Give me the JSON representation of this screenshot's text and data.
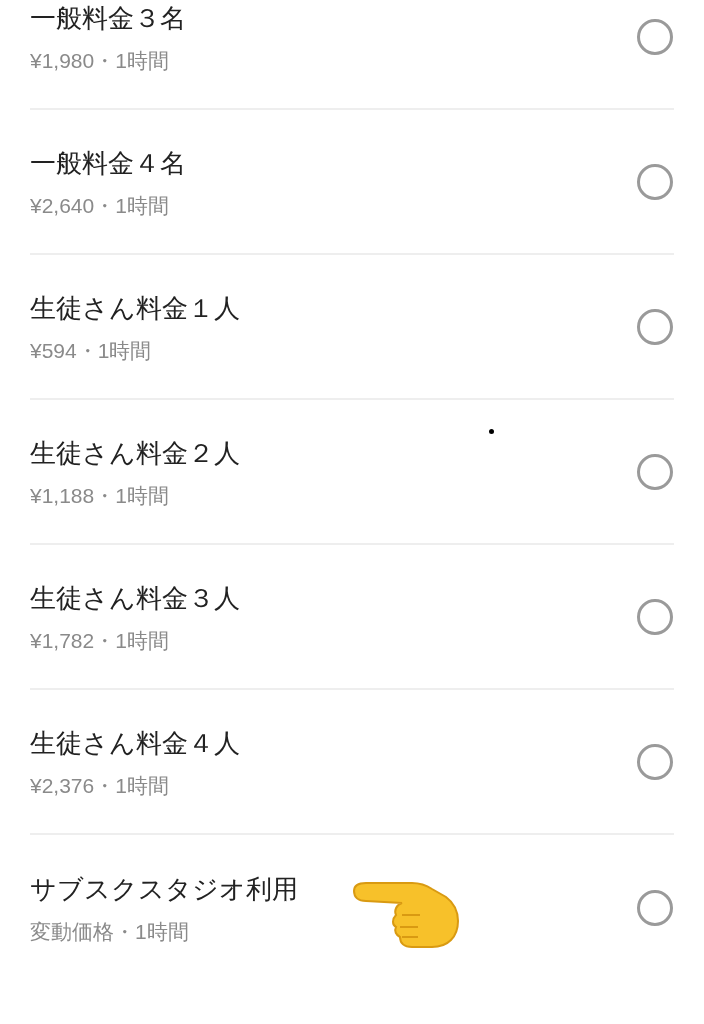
{
  "options": [
    {
      "title": "一般料金３名",
      "detail": "¥1,980・1時間",
      "selected": false,
      "pointed": false
    },
    {
      "title": "一般料金４名",
      "detail": "¥2,640・1時間",
      "selected": false,
      "pointed": false
    },
    {
      "title": "生徒さん料金１人",
      "detail": "¥594・1時間",
      "selected": false,
      "pointed": false
    },
    {
      "title": "生徒さん料金２人",
      "detail": "¥1,188・1時間",
      "selected": false,
      "pointed": false
    },
    {
      "title": "生徒さん料金３人",
      "detail": "¥1,782・1時間",
      "selected": false,
      "pointed": false
    },
    {
      "title": "生徒さん料金４人",
      "detail": "¥2,376・1時間",
      "selected": false,
      "pointed": false
    },
    {
      "title": "サブスクスタジオ利用",
      "detail": "変動価格・1時間",
      "selected": false,
      "pointed": true
    }
  ]
}
